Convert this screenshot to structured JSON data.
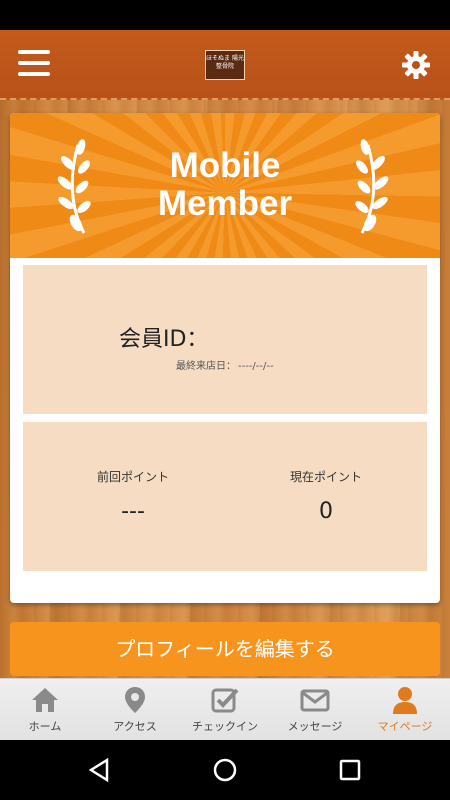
{
  "header": {
    "logo_text": "ほそぬま 陽光整骨院",
    "menu_icon": "hamburger-menu-icon",
    "settings_icon": "gear-icon"
  },
  "banner": {
    "title": "Mobile\nMember"
  },
  "member": {
    "id_label": "会員ID：",
    "last_visit_label": "最終来店日：",
    "last_visit_value": "----/--/--"
  },
  "points": {
    "previous_label": "前回ポイント",
    "previous_value": "---",
    "current_label": "現在ポイント",
    "current_value": "0"
  },
  "edit_profile_label": "プロフィールを編集する",
  "tabs": [
    {
      "label": "ホーム",
      "icon": "home-icon"
    },
    {
      "label": "アクセス",
      "icon": "map-pin-icon"
    },
    {
      "label": "チェックイン",
      "icon": "checkin-icon"
    },
    {
      "label": "メッセージ",
      "icon": "mail-icon"
    },
    {
      "label": "マイページ",
      "icon": "person-icon",
      "active": true
    }
  ],
  "colors": {
    "header": "#b8521a",
    "accent": "#f7941d",
    "panel": "#f5dcc3",
    "active_tab": "#e07a1f"
  }
}
